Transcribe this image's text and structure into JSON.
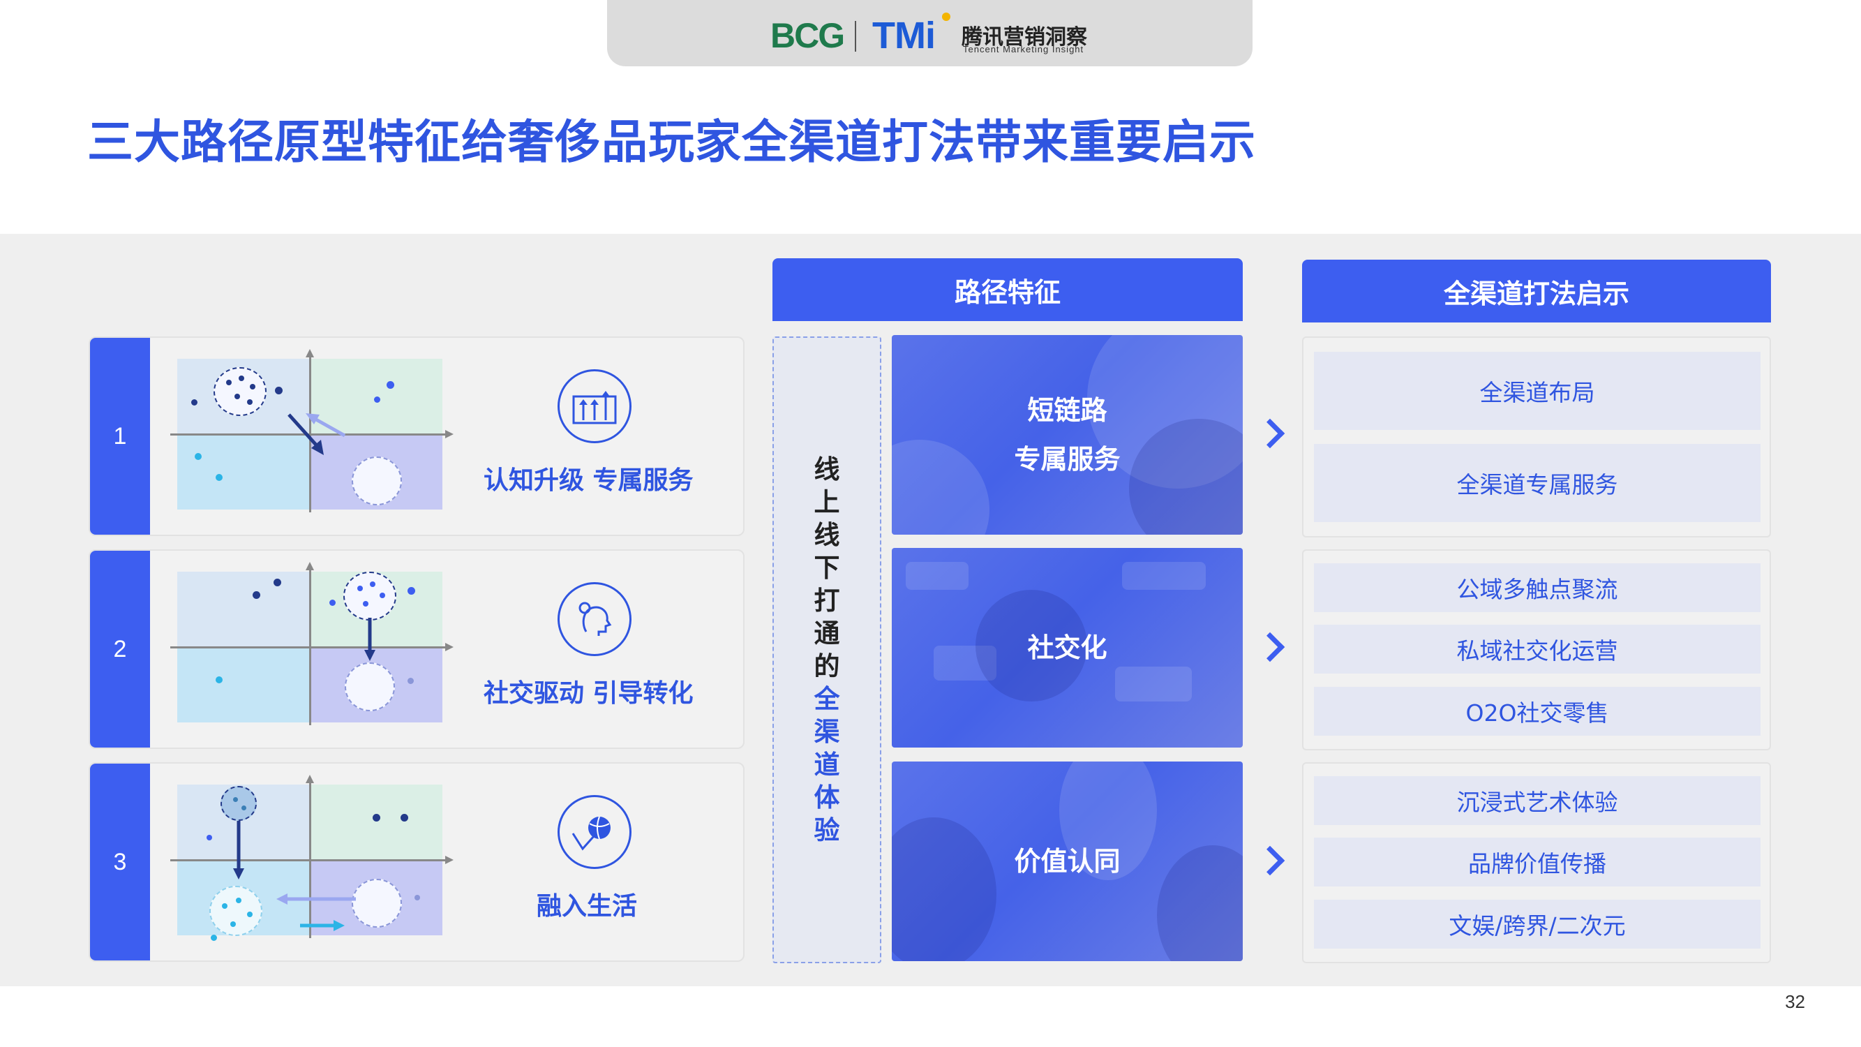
{
  "header": {
    "logo_bcg": "BCG",
    "logo_tmi": "TMi",
    "logo_tmi_cn": "腾讯营销洞察",
    "logo_tmi_en": "Tencent Marketing Insight"
  },
  "title": "三大路径原型特征给奢侈品玩家全渠道打法带来重要启示",
  "columns": {
    "path_features": "路径特征",
    "omnichannel": "全渠道打法启示"
  },
  "rows": [
    {
      "num": "1",
      "label": "认知升级 专属服务",
      "icon": "growth-arrows-icon"
    },
    {
      "num": "2",
      "label": "社交驱动 引导转化",
      "icon": "social-head-icon"
    },
    {
      "num": "3",
      "label": "融入生活",
      "icon": "basketball-check-icon"
    }
  ],
  "vertical": {
    "dark": [
      "线",
      "上",
      "线",
      "下",
      "打",
      "通",
      "的"
    ],
    "blue": [
      "全",
      "渠",
      "道",
      "体",
      "验"
    ]
  },
  "features": [
    {
      "line1": "短链路",
      "line2": "专属服务"
    },
    {
      "line1": "社交化",
      "line2": ""
    },
    {
      "line1": "价值认同",
      "line2": ""
    }
  ],
  "implications": [
    [
      "全渠道布局",
      "全渠道专属服务"
    ],
    [
      "公域多触点聚流",
      "私域社交化运营",
      "O2O社交零售"
    ],
    [
      "沉浸式艺术体验",
      "品牌价值传播",
      "文娱/跨界/二次元"
    ]
  ],
  "page_number": "32",
  "colors": {
    "accent": "#3d5ef0",
    "title_blue": "#2f55e0",
    "bcg_green": "#1f7a4c"
  }
}
